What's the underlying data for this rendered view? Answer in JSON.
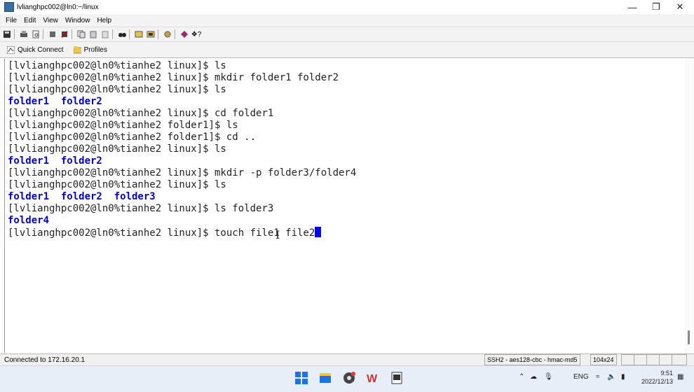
{
  "window": {
    "title": "lvlianghpc002@ln0:~/linux"
  },
  "menu": [
    "File",
    "Edit",
    "View",
    "Window",
    "Help"
  ],
  "quickbar": {
    "quick_connect": "Quick Connect",
    "profiles": "Profiles"
  },
  "terminal": {
    "lines": [
      "[lvlianghpc002@ln0%tianhe2 linux]$ ls",
      "[lvlianghpc002@ln0%tianhe2 linux]$ mkdir folder1 folder2",
      "[lvlianghpc002@ln0%tianhe2 linux]$ ls",
      "folder1  folder2",
      "[lvlianghpc002@ln0%tianhe2 linux]$ cd folder1",
      "[lvlianghpc002@ln0%tianhe2 folder1]$ ls",
      "[lvlianghpc002@ln0%tianhe2 folder1]$ cd ..",
      "[lvlianghpc002@ln0%tianhe2 linux]$ ls",
      "folder1  folder2",
      "[lvlianghpc002@ln0%tianhe2 linux]$ mkdir -p folder3/folder4",
      "[lvlianghpc002@ln0%tianhe2 linux]$ ls",
      "folder1  folder2  folder3",
      "[lvlianghpc002@ln0%tianhe2 linux]$ ls folder3",
      "folder4",
      "[lvlianghpc002@ln0%tianhe2 linux]$ touch file1 file2"
    ],
    "dir_line_indices": [
      3,
      8,
      11,
      13
    ]
  },
  "status": {
    "connection": "Connected to 172.16.20.1",
    "cipher": "SSH2 - aes128-cbc - hmac-md5",
    "size": "104x24"
  },
  "tray": {
    "lang": "ENG",
    "time": "9:51",
    "date": "2022/12/13"
  },
  "colors": {
    "directory": "#0000cc",
    "cursor": "#0000ff",
    "taskbar": "#e8eef7"
  }
}
